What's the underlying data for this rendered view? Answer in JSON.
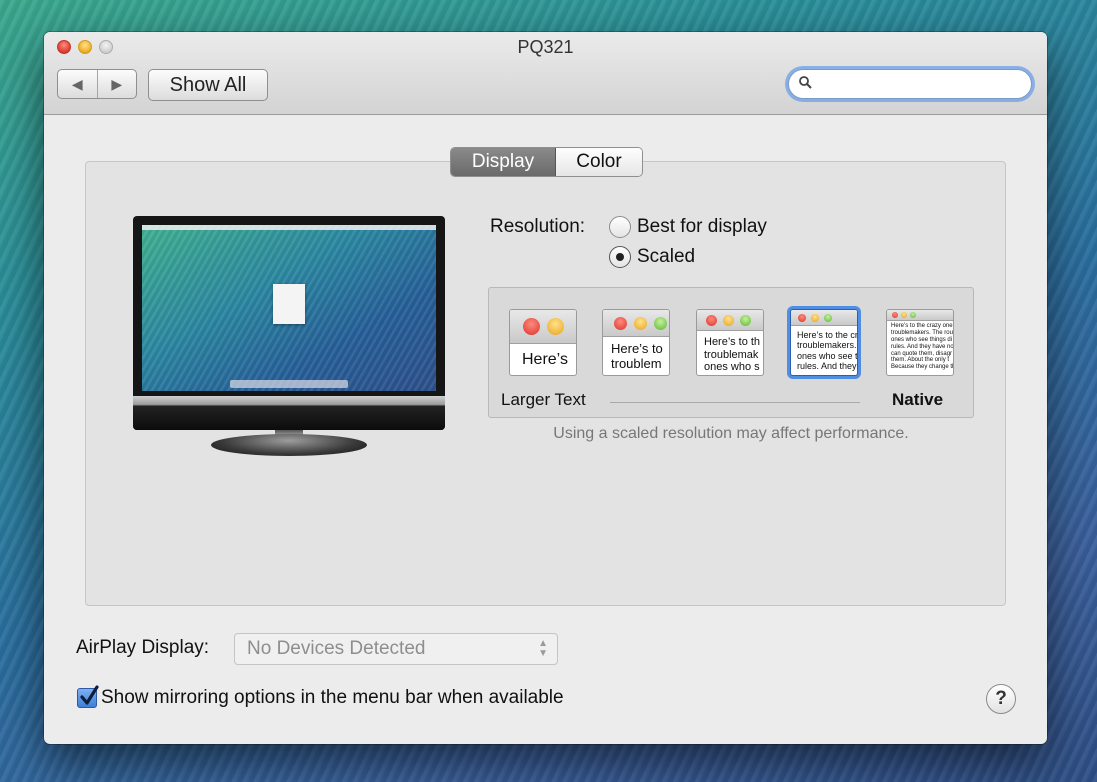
{
  "window": {
    "title": "PQ321"
  },
  "toolbar": {
    "back_icon": "back-arrow-icon",
    "forward_icon": "forward-arrow-icon",
    "back_glyph": "◀",
    "forward_glyph": "▶",
    "show_all_label": "Show All",
    "search_placeholder": "",
    "search_icon": "magnifier-icon"
  },
  "tabs": [
    {
      "label": "Display",
      "active": true
    },
    {
      "label": "Color",
      "active": false
    }
  ],
  "resolution": {
    "label": "Resolution:",
    "options": [
      {
        "label": "Best for display",
        "selected": false
      },
      {
        "label": "Scaled",
        "selected": true
      }
    ]
  },
  "scaled": {
    "thumbs": [
      {
        "text": "Here’s",
        "selected": false
      },
      {
        "text": "Here’s to\ntroublem",
        "selected": false
      },
      {
        "text": "Here’s to th\ntroublemak\nones who s",
        "selected": false
      },
      {
        "text": "Here’s to the cr\ntroublemakers.\nones who see t\nrules. And they",
        "selected": true
      },
      {
        "text": "Here’s to the crazy one\ntroublemakers. The rou\nones who see things di\nrules. And they have no\ncan quote them, disagr\nthem. About the only t\nBecause they change th",
        "selected": false
      }
    ],
    "left_label": "Larger Text",
    "right_label": "Native",
    "note": "Using a scaled resolution may affect performance."
  },
  "airplay": {
    "label": "AirPlay Display:",
    "value": "No Devices Detected",
    "arrows_glyph": "▲\n▼"
  },
  "mirroring": {
    "label": "Show mirroring options in the menu bar when available",
    "checked": true
  },
  "help": {
    "label": "?"
  },
  "colors": {
    "selection_blue": "#4f8ee3",
    "active_tab": "#7a7a7a",
    "close_red": "#e0443a",
    "minimize_yellow": "#f1b331"
  }
}
